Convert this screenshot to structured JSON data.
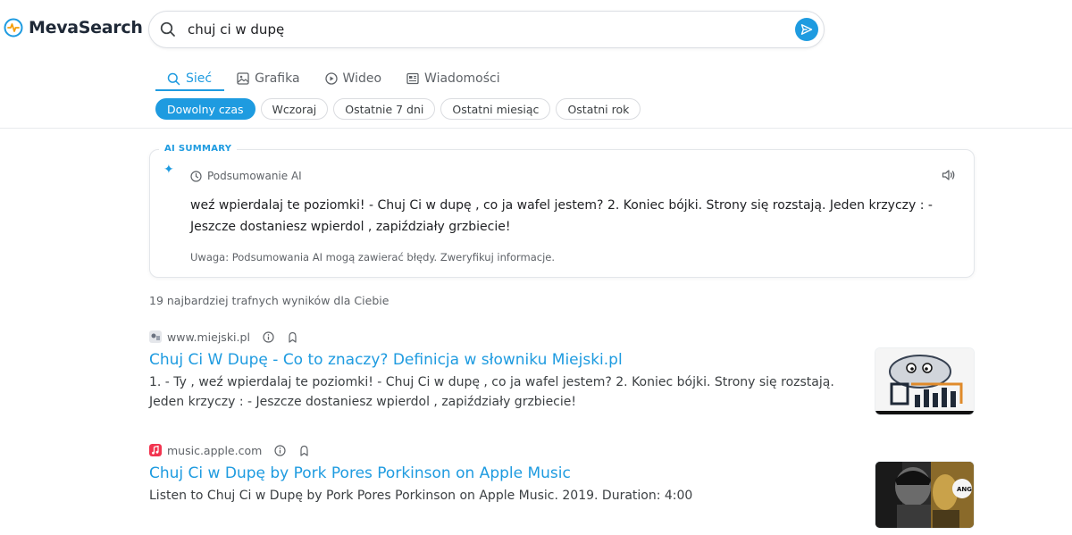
{
  "brand": {
    "name": "MevaSearch",
    "accent": "#1e9be0"
  },
  "search": {
    "query": "chuj ci w dupę",
    "placeholder": ""
  },
  "tabs": [
    {
      "label": "Sieć",
      "icon": "search-icon",
      "active": true
    },
    {
      "label": "Grafika",
      "icon": "image-icon",
      "active": false
    },
    {
      "label": "Wideo",
      "icon": "play-icon",
      "active": false
    },
    {
      "label": "Wiadomości",
      "icon": "news-icon",
      "active": false
    }
  ],
  "filters": [
    {
      "label": "Dowolny czas",
      "active": true
    },
    {
      "label": "Wczoraj",
      "active": false
    },
    {
      "label": "Ostatnie 7 dni",
      "active": false
    },
    {
      "label": "Ostatni miesiąc",
      "active": false
    },
    {
      "label": "Ostatni rok",
      "active": false
    }
  ],
  "ai_summary": {
    "label": "AI SUMMARY",
    "heading": "Podsumowanie AI",
    "text": "weź wpierdalaj te poziomki! - Chuj Ci w dupę , co ja wafel jestem? 2. Koniec bójki. Strony się rozstają. Jeden krzyczy : - Jeszcze dostaniesz wpierdol , zapiździały grzbiecie!",
    "note": "Uwaga: Podsumowania AI mogą zawierać błędy. Zweryfikuj informacje."
  },
  "result_count_text": "19 najbardziej trafnych wyników dla Ciebie",
  "results": [
    {
      "domain": "www.miejski.pl",
      "title": "Chuj Ci W Dupę - Co to znaczy? Definicja w słowniku Miejski.pl",
      "snippet": "1. - Ty , weź wpierdalaj te poziomki! - Chuj Ci w dupę , co ja wafel jestem? 2. Koniec bójki. Strony się rozstają. Jeden krzyczy : - Jeszcze dostaniesz wpierdol , zapiździały grzbiecie!"
    },
    {
      "domain": "music.apple.com",
      "title": "Chuj Ci w Dupę by Pork Pores Porkinson on Apple Music",
      "snippet": "Listen to Chuj Ci w Dupę by Pork Pores Porkinson on Apple Music. 2019. Duration: 4:00"
    }
  ]
}
